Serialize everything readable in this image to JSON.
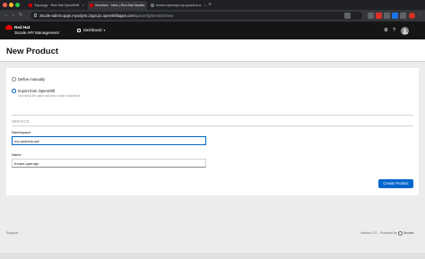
{
  "browser": {
    "tabs": [
      {
        "title": "Topology · Red Hat OpenShift",
        "active": false,
        "favicon_color": "#cc0000"
      },
      {
        "title": "Services · New | Red Hat 3scale",
        "active": true,
        "favicon_color": "#cc0000"
      },
      {
        "title": "rhoam-openapi-my-quarkus-a",
        "active": false,
        "favicon_color": "#6a6e73"
      }
    ],
    "new_tab_glyph": "+",
    "url_host": "3scale-admin.apps.myodyne.24g4.p1.openshiftapps.com",
    "url_path": "/apiconfig/services/new",
    "extension_colors": [
      "#5f6368",
      "#5f6368",
      "#5f6368",
      "#d93025",
      "#5f6368",
      "#1a73e8",
      "#5f6368",
      "#5f6368",
      "#5f6368",
      "#d93025"
    ]
  },
  "header": {
    "brand_line1": "Red Hat",
    "brand_line2": "3scale API Management",
    "context_selector": "Dashboard",
    "icons": [
      "gear-icon",
      "help-icon",
      "user-avatar"
    ]
  },
  "page": {
    "title": "New Product"
  },
  "form": {
    "option_manual": "Define manually",
    "option_openshift": "Import from OpenShift",
    "openshift_help": "Choosing this option will also create a Backend",
    "selected_option": "openshift",
    "section_title": "SERVICE",
    "namespace_label": "Namespace",
    "namespace_value": "my-quarkus-api",
    "name_label": "Name",
    "name_value": "rhoam-openapi",
    "submit_label": "Create Product"
  },
  "footer": {
    "support": "Support",
    "version": "Version 2.9 – Powered by",
    "logo_text": "3scale"
  },
  "colors": {
    "accent": "#0066cc",
    "masthead": "#151515",
    "brand_red": "#ee0000"
  }
}
